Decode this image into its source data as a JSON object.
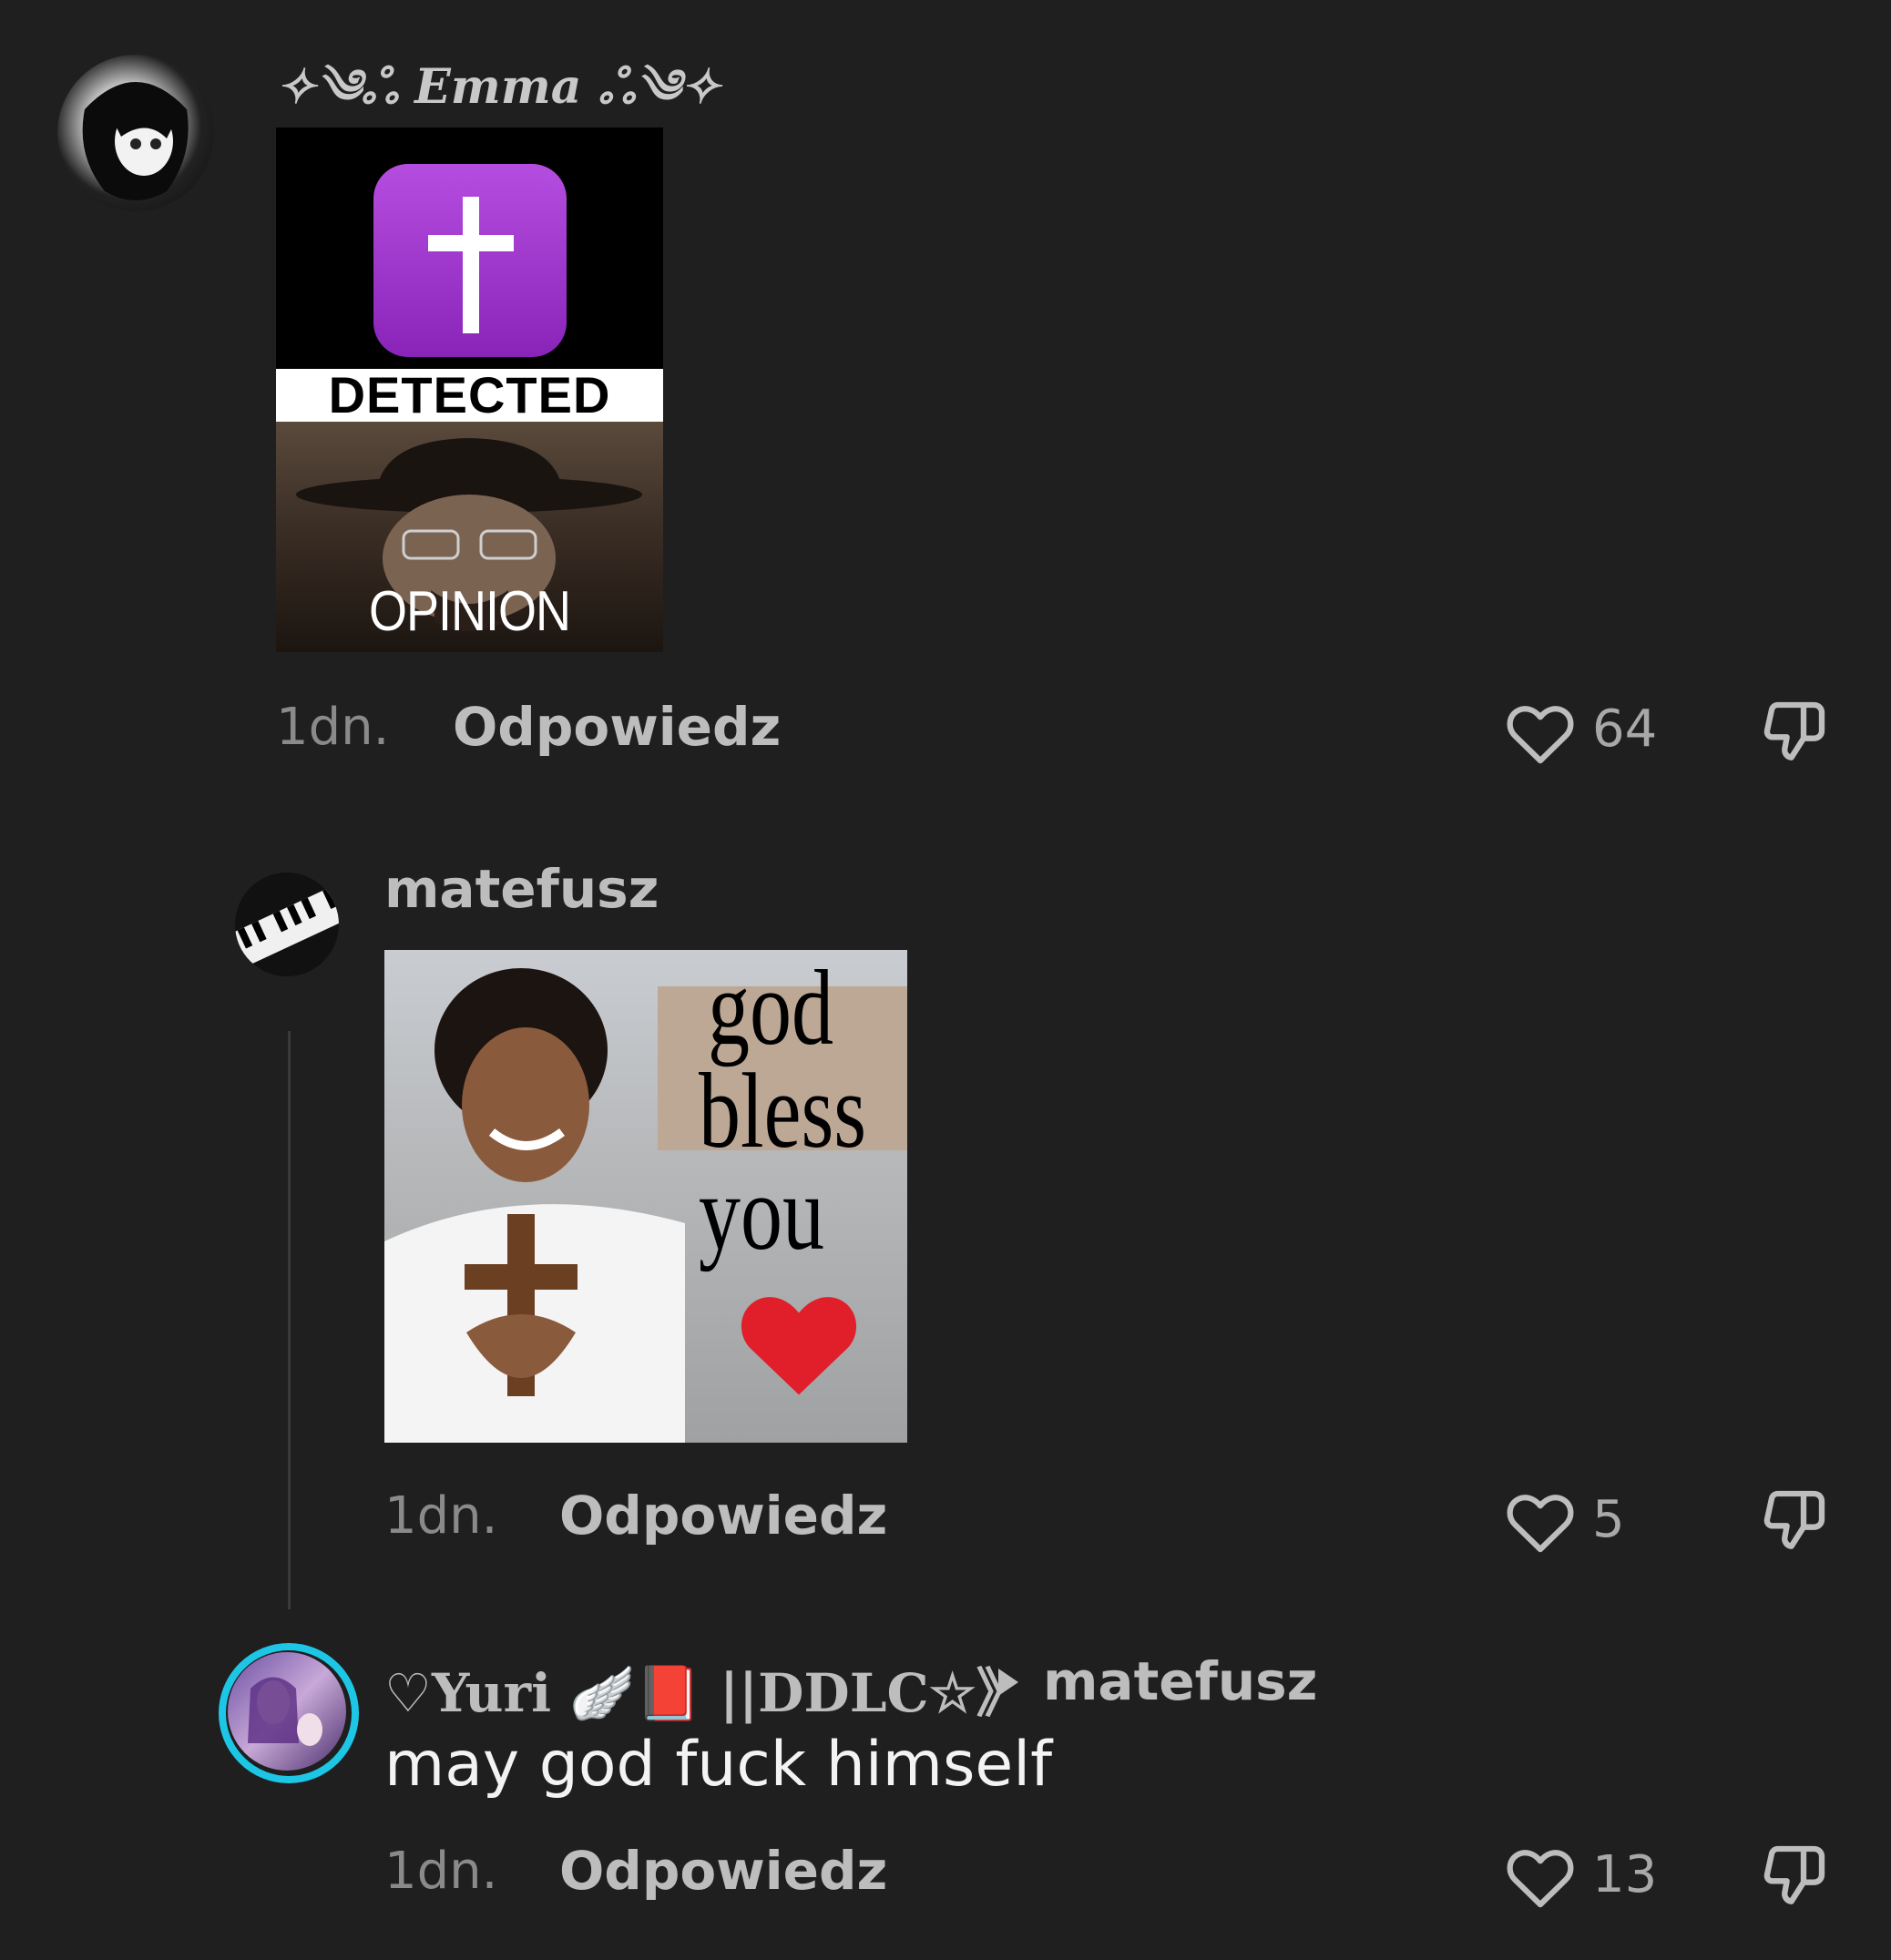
{
  "comments": [
    {
      "username": "✧༄ஃ Emma ஃ༄✧",
      "image_top_label": "DETECTED",
      "image_bottom_label": "OPINION REJECTED",
      "time": "1dn.",
      "reply_label": "Odpowiedz",
      "likes": "64"
    },
    {
      "username": "matefusz",
      "image_text": [
        "god",
        "bless",
        "you"
      ],
      "time": "1dn.",
      "reply_label": "Odpowiedz",
      "likes": "5"
    },
    {
      "username": "♡Yuri 🪽📕 ||DDLC☆》",
      "reply_to": "matefusz",
      "text": "may god fuck himself",
      "time": "1dn.",
      "reply_label": "Odpowiedz",
      "likes": "13"
    }
  ],
  "colors": {
    "background": "#1f1f1f",
    "cross_tile": "#9b2fc8",
    "heart_emoji": "#e01f2a",
    "story_ring": "#1ec6e6"
  },
  "icons": [
    "heart-outline-icon",
    "dislike-icon",
    "play-triangle-icon",
    "cross-icon",
    "angel-wing-icon",
    "red-book-icon"
  ]
}
